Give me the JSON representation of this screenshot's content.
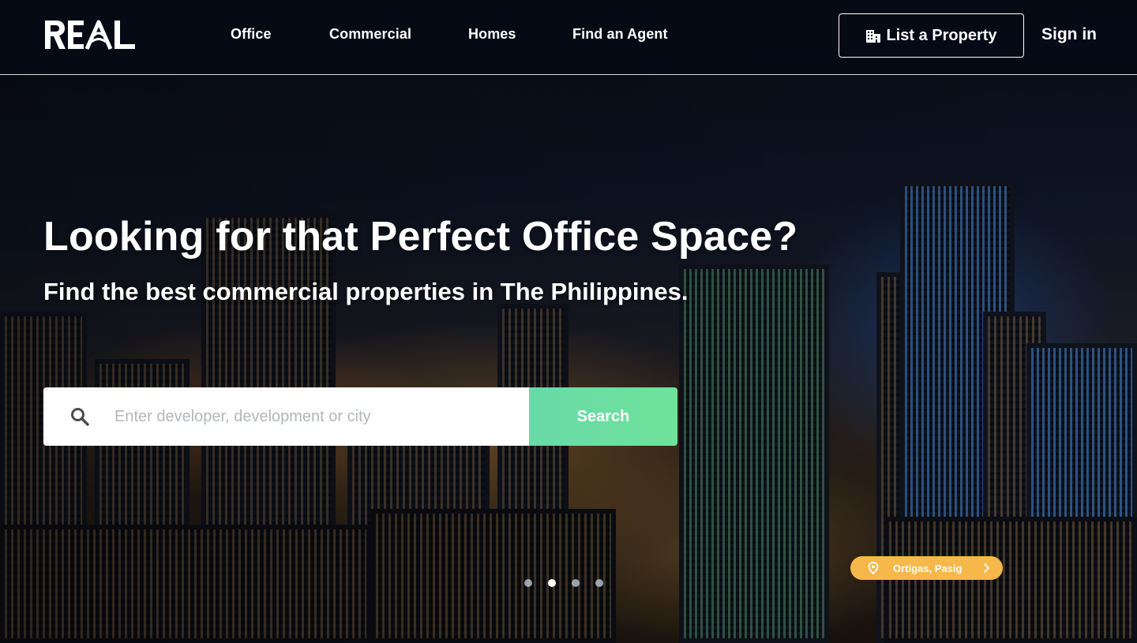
{
  "brand": {
    "logo_text": "REAL"
  },
  "nav": {
    "items": [
      {
        "label": "Office"
      },
      {
        "label": "Commercial"
      },
      {
        "label": "Homes"
      },
      {
        "label": "Find an Agent"
      }
    ],
    "list_property_label": "List a Property",
    "sign_in_label": "Sign in"
  },
  "hero": {
    "headline": "Looking for that Perfect Office Space?",
    "subheadline": "Find the best commercial properties in The Philippines.",
    "search": {
      "value": "",
      "placeholder": "Enter developer, development or city",
      "button_label": "Search"
    },
    "carousel": {
      "slide_count": 4,
      "active_index": 1
    },
    "location_label": "Ortigas, Pasig"
  },
  "colors": {
    "search_button": "#6ee39a",
    "location_pill": "#f6b84a",
    "header_bg": "#060a16"
  },
  "icons": {
    "search": "search-icon",
    "building": "building-icon",
    "pin": "map-pin-icon",
    "chevron": "chevron-right-icon"
  }
}
